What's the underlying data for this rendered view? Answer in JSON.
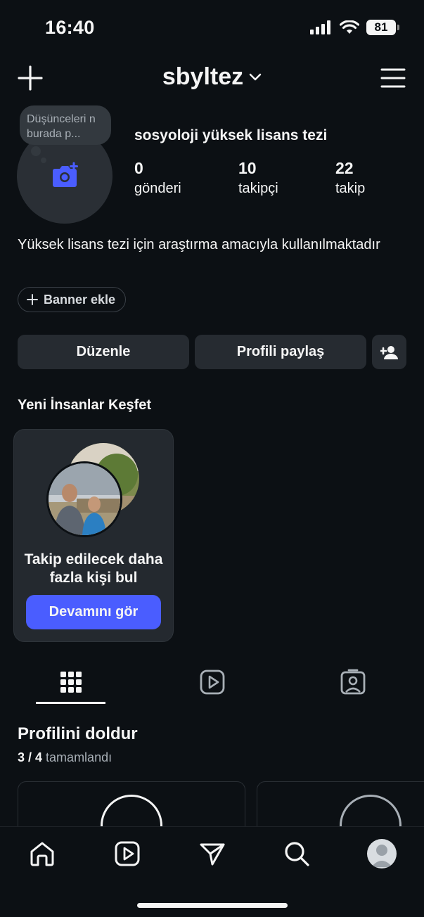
{
  "status_bar": {
    "time": "16:40",
    "battery": "81"
  },
  "header": {
    "username": "sbyltez"
  },
  "profile": {
    "note": "Düşünceleri n burada p...",
    "display_name": "sosyoloji yüksek lisans tezi",
    "stats": [
      {
        "value": "0",
        "label": "gönderi"
      },
      {
        "value": "10",
        "label": "takipçi"
      },
      {
        "value": "22",
        "label": "takip"
      }
    ],
    "bio": "Yüksek lisans tezi için araştırma amacıyla kullanılmaktadır",
    "banner_button": "Banner ekle"
  },
  "actions": {
    "edit": "Düzenle",
    "share": "Profili paylaş"
  },
  "discover": {
    "title": "Yeni İnsanlar Keşfet",
    "card_text": "Takip edilecek daha fazla kişi bul",
    "card_button": "Devamını gör"
  },
  "complete": {
    "title": "Profilini doldur",
    "progress": "3 / 4",
    "progress_suffix": "tamamlandı"
  },
  "colors": {
    "background": "#0c1014",
    "accent": "#4a5dff",
    "button": "#262b31"
  },
  "icons": {
    "header": [
      "plus-icon",
      "chevron-down-icon",
      "menu-icon"
    ],
    "tabs": [
      "grid-icon",
      "reels-icon",
      "tagged-icon"
    ],
    "nav": [
      "home-icon",
      "reels-icon",
      "direct-icon",
      "search-icon",
      "profile-avatar"
    ]
  }
}
